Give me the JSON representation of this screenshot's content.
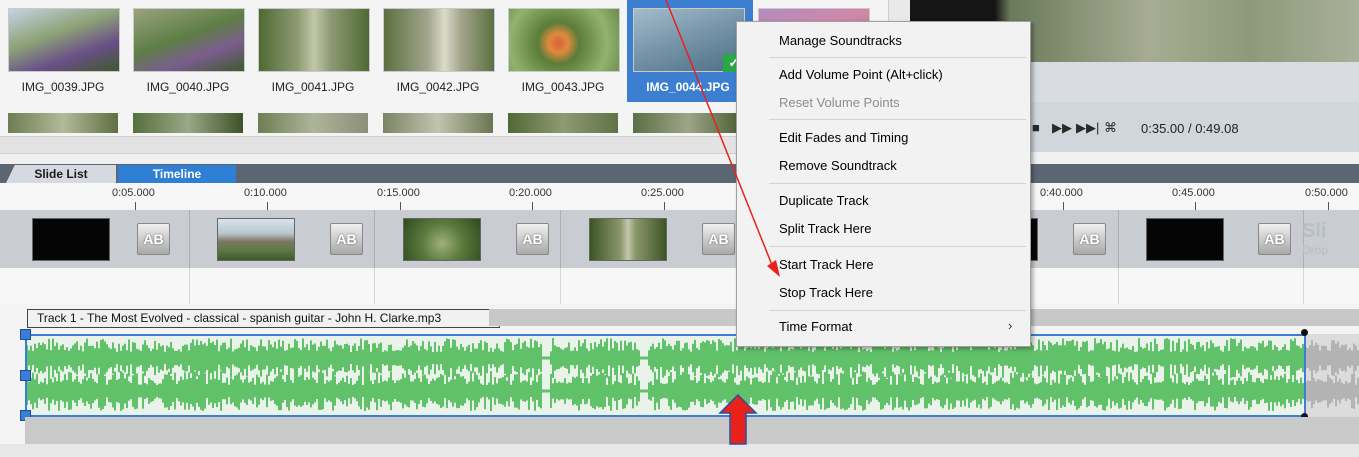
{
  "thumbnails": [
    {
      "label": "IMG_0039.JPG",
      "colors": [
        "#6e8a5a",
        "#c6d3e4",
        "#6a4f88"
      ]
    },
    {
      "label": "IMG_0040.JPG",
      "colors": [
        "#5e7e46",
        "#9aa37d",
        "#3d5a2f"
      ]
    },
    {
      "label": "IMG_0041.JPG",
      "colors": [
        "#8f9a74",
        "#c1c8a8",
        "#4e6a34"
      ]
    },
    {
      "label": "IMG_0042.JPG",
      "colors": [
        "#a3a58c",
        "#dadbc9",
        "#5b7040"
      ]
    },
    {
      "label": "IMG_0043.JPG",
      "colors": [
        "#5a7d3a",
        "#d7603c",
        "#93b26f"
      ]
    },
    {
      "label": "IMG_0044.JPG",
      "colors": [
        "#4c6e84",
        "#7997ab",
        "#a4bccc"
      ],
      "selected": true
    }
  ],
  "transport": {
    "time": "0:35.00 / 0:49.08",
    "play_icons": [
      "stop-icon",
      "fast-forward-icon",
      "skip-end-icon",
      "fullscreen-icon"
    ]
  },
  "tabs": {
    "slide_list": "Slide List",
    "timeline": "Timeline"
  },
  "ruler": [
    "0:05.000",
    "0:10.000",
    "0:15.000",
    "0:20.000",
    "0:25.000",
    "0:40.000",
    "0:45.000",
    "0:50.000"
  ],
  "slides": {
    "transition_label": "AB",
    "drop_label": "Sli",
    "drop_sub": "Drop"
  },
  "track": {
    "title": "Track 1 - The Most Evolved - classical - spanish guitar - John H. Clarke.mp3"
  },
  "context_menu": {
    "items": [
      {
        "label": "Manage Soundtracks",
        "disabled": false
      },
      {
        "label": "Add Volume Point (Alt+click)",
        "disabled": false
      },
      {
        "label": "Reset Volume Points",
        "disabled": true
      },
      {
        "label": "Edit Fades and Timing",
        "disabled": false
      },
      {
        "label": "Remove Soundtrack",
        "disabled": false
      },
      {
        "label": "Duplicate Track",
        "disabled": false
      },
      {
        "label": "Split Track Here",
        "disabled": false
      },
      {
        "label": "Start Track Here",
        "disabled": false
      },
      {
        "label": "Stop Track Here",
        "disabled": false
      },
      {
        "label": "Time Format",
        "disabled": false,
        "submenu": true
      }
    ]
  },
  "colors": {
    "accent": "#2f7fd4",
    "waveform": "#3fb54a",
    "annotation": "#e8221b"
  }
}
